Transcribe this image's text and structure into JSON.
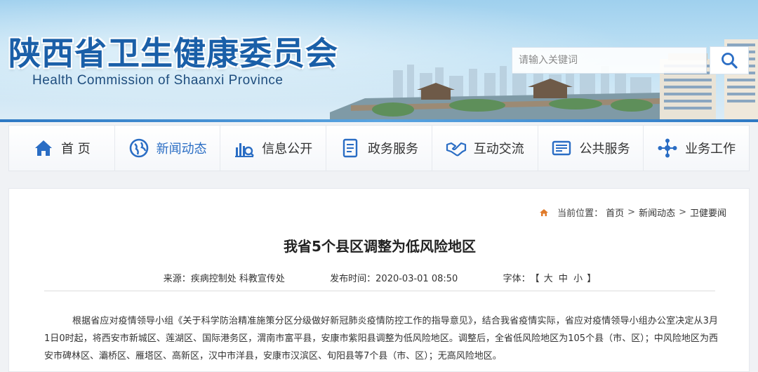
{
  "site": {
    "title": "陕西省卫生健康委员会",
    "subtitle": "Health Commission of Shaanxi Province"
  },
  "search": {
    "placeholder": "请输入关键词",
    "icon": "search-icon"
  },
  "nav": {
    "items": [
      {
        "label": "首 页",
        "icon": "home-icon"
      },
      {
        "label": "新闻动态",
        "icon": "globe-icon"
      },
      {
        "label": "信息公开",
        "icon": "chart-search-icon"
      },
      {
        "label": "政务服务",
        "icon": "document-icon"
      },
      {
        "label": "互动交流",
        "icon": "handshake-icon"
      },
      {
        "label": "公共服务",
        "icon": "card-icon"
      },
      {
        "label": "业务工作",
        "icon": "network-icon"
      }
    ]
  },
  "breadcrumb": {
    "prefix": "当前位置：",
    "items": [
      "首页",
      "新闻动态",
      "卫健要闻"
    ],
    "separator": ">"
  },
  "article": {
    "title": "我省5个县区调整为低风险地区",
    "source": "来源：疾病控制处 科教宣传处",
    "published": "发布时间：2020-03-01 08:50",
    "font_label": "字体：",
    "font_sizes": {
      "open": "【",
      "large": "大",
      "medium": "中",
      "small": "小",
      "close": "】"
    },
    "body": "根据省应对疫情领导小组《关于科学防治精准施策分区分级做好新冠肺炎疫情防控工作的指导意见》，结合我省疫情实际，省应对疫情领导小组办公室决定从3月1日0时起，将西安市新城区、莲湖区、国际港务区，渭南市富平县，安康市紫阳县调整为低风险地区。调整后，全省低风险地区为105个县（市、区）；中风险地区为西安市碑林区、灞桥区、雁塔区、高新区，汉中市洋县，安康市汉滨区、旬阳县等7个县（市、区）；无高风险地区。"
  },
  "colors": {
    "title_blue": "#1a5fa8",
    "nav_active": "#2a6dc4",
    "icon_blue": "#2a6dc4",
    "breadcrumb_home": "#e07b2a"
  }
}
